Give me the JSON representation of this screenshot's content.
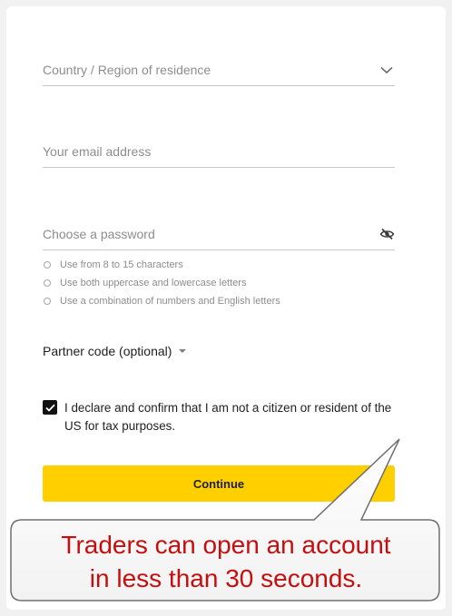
{
  "form": {
    "country_placeholder": "Country / Region of residence",
    "email_placeholder": "Your email address",
    "password_placeholder": "Choose a password",
    "password_rules": [
      "Use from 8 to 15 characters",
      "Use both uppercase and lowercase letters",
      "Use a combination of numbers and English letters"
    ],
    "partner_label": "Partner code (optional)",
    "declaration_text": "I declare and confirm that I am not a citizen or resident of the US for tax purposes.",
    "declaration_checked": true,
    "continue_label": "Continue"
  },
  "callout": {
    "line1": "Traders can open an account",
    "line2": "in less than 30 seconds."
  },
  "icons": {
    "country_trailing": "chevron-down-icon",
    "password_trailing": "eye-slash-icon",
    "partner_caret": "caret-down-icon",
    "checkbox_mark": "checkmark-icon"
  },
  "colors": {
    "accent": "#ffcf00",
    "callout_text": "#c50f0f",
    "placeholder": "#8d8d8d",
    "field_border": "#c9c9c9"
  }
}
